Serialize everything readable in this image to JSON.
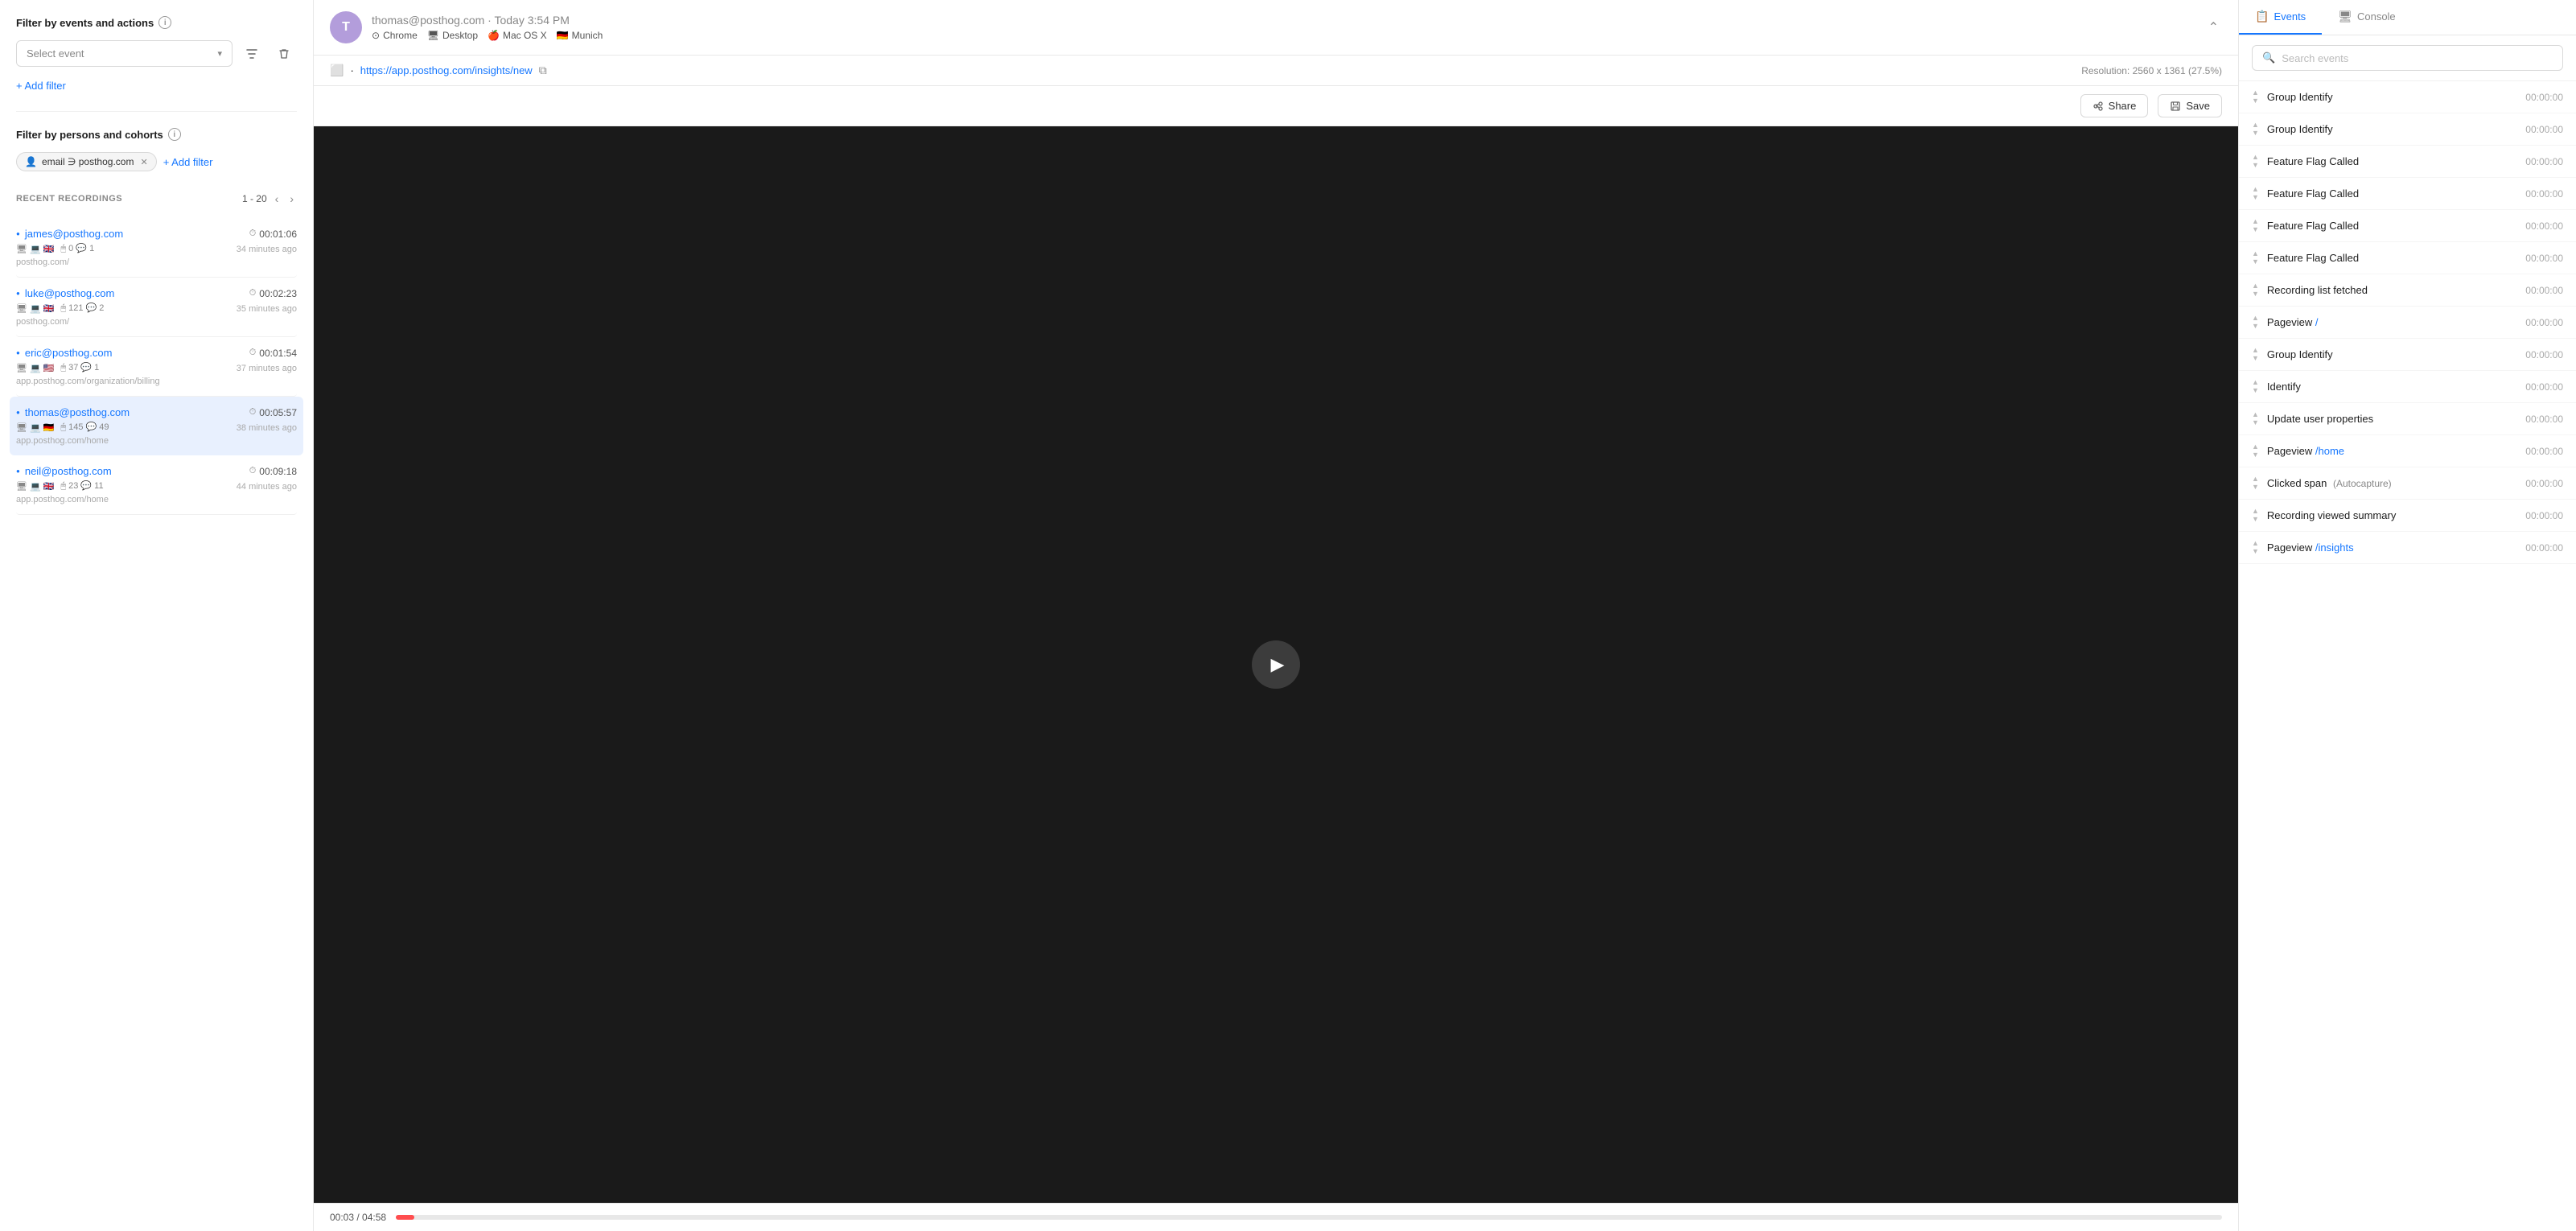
{
  "sidebar": {
    "filter_title": "Filter by events and actions",
    "select_event_placeholder": "Select event",
    "add_filter_label": "+ Add filter",
    "cohort_title": "Filter by persons and cohorts",
    "cohort_tag": "email ∋ posthog.com",
    "add_cohort_label": "+ Add filter",
    "recordings_title": "RECENT RECORDINGS",
    "pagination": "1 - 20",
    "recordings": [
      {
        "email": "james@posthog.com",
        "duration": "00:01:06",
        "icons": "🖥 💻 🇬🇧",
        "counts": "0 ● 1",
        "time_ago": "34 minutes ago",
        "url": "posthog.com/",
        "active": false
      },
      {
        "email": "luke@posthog.com",
        "duration": "00:02:23",
        "icons": "🖥 💻 🇬🇧",
        "counts": "121 ● 2",
        "time_ago": "35 minutes ago",
        "url": "posthog.com/",
        "active": false
      },
      {
        "email": "eric@posthog.com",
        "duration": "00:01:54",
        "icons": "🖥 💻 🇺🇸",
        "counts": "37 ● 1",
        "time_ago": "37 minutes ago",
        "url": "app.posthog.com/organization/billing",
        "active": false
      },
      {
        "email": "thomas@posthog.com",
        "duration": "00:05:57",
        "icons": "🖥 💻 🇩🇪",
        "counts": "145 ● 49",
        "time_ago": "38 minutes ago",
        "url": "app.posthog.com/home",
        "active": true
      },
      {
        "email": "neil@posthog.com",
        "duration": "00:09:18",
        "icons": "🖥 💻 🇬🇧",
        "counts": "23 ● 11",
        "time_ago": "44 minutes ago",
        "url": "app.posthog.com/home",
        "active": false
      }
    ]
  },
  "session": {
    "avatar_initials": "T",
    "user_email": "thomas@posthog.com",
    "datetime": "Today 3:54 PM",
    "browser": "Chrome",
    "device": "Desktop",
    "os": "Mac OS X",
    "location": "Munich",
    "url": "https://app.posthog.com/insights/new",
    "resolution": "Resolution: 2560 x 1361 (27.5%)",
    "share_label": "Share",
    "save_label": "Save",
    "time_current": "00:03",
    "time_total": "04:58"
  },
  "right_panel": {
    "tabs": [
      {
        "label": "Events",
        "icon": "📋",
        "active": true
      },
      {
        "label": "Console",
        "icon": "🖥",
        "active": false
      }
    ],
    "search_placeholder": "Search events",
    "events": [
      {
        "name": "Group Identify",
        "path": "",
        "badge": "",
        "time": "00:00:00"
      },
      {
        "name": "Group Identify",
        "path": "",
        "badge": "",
        "time": "00:00:00"
      },
      {
        "name": "Feature Flag Called",
        "path": "",
        "badge": "",
        "time": "00:00:00"
      },
      {
        "name": "Feature Flag Called",
        "path": "",
        "badge": "",
        "time": "00:00:00"
      },
      {
        "name": "Feature Flag Called",
        "path": "",
        "badge": "",
        "time": "00:00:00"
      },
      {
        "name": "Feature Flag Called",
        "path": "",
        "badge": "",
        "time": "00:00:00"
      },
      {
        "name": "Recording list fetched",
        "path": "",
        "badge": "",
        "time": "00:00:00"
      },
      {
        "name": "Pageview",
        "path": "/",
        "badge": "",
        "time": "00:00:00"
      },
      {
        "name": "Group Identify",
        "path": "",
        "badge": "",
        "time": "00:00:00"
      },
      {
        "name": "Identify",
        "path": "",
        "badge": "",
        "time": "00:00:00"
      },
      {
        "name": "Update user properties",
        "path": "",
        "badge": "",
        "time": "00:00:00"
      },
      {
        "name": "Pageview",
        "path": "/home",
        "badge": "",
        "time": "00:00:00"
      },
      {
        "name": "Clicked span",
        "path": "",
        "badge": "(Autocapture)",
        "time": "00:00:00"
      },
      {
        "name": "Recording viewed summary",
        "path": "",
        "badge": "",
        "time": "00:00:00"
      },
      {
        "name": "Pageview",
        "path": "/insights",
        "badge": "",
        "time": "00:00:00"
      }
    ]
  }
}
